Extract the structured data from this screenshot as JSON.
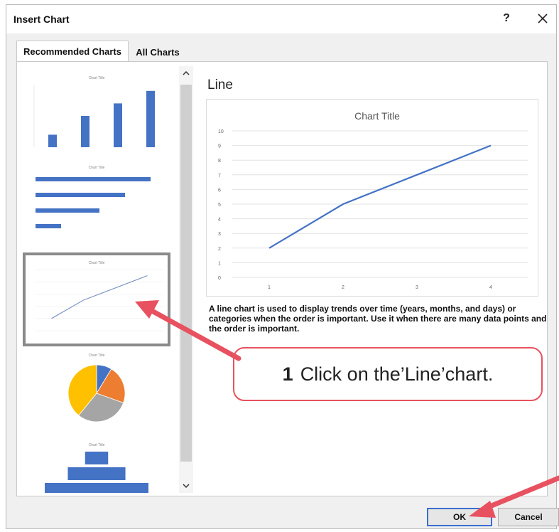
{
  "window": {
    "title": "Insert Chart",
    "help": "?",
    "close_icon": "close-icon"
  },
  "tabs": [
    {
      "label": "Recommended Charts",
      "active": true
    },
    {
      "label": "All Charts",
      "active": false
    }
  ],
  "thumbnails": [
    {
      "kind": "clustered-column",
      "title": "Chart Title",
      "values": [
        2,
        5,
        7,
        9
      ]
    },
    {
      "kind": "clustered-bar",
      "title": "Chart Title",
      "values": [
        9,
        7,
        5,
        2
      ]
    },
    {
      "kind": "line",
      "title": "Chart Title",
      "values": [
        2,
        5,
        7,
        9
      ],
      "selected": true
    },
    {
      "kind": "pie",
      "title": "Chart Title",
      "values": [
        2,
        5,
        7,
        9
      ]
    },
    {
      "kind": "funnel",
      "title": "Chart Title",
      "values": [
        2,
        5,
        9
      ]
    }
  ],
  "preview": {
    "name": "Line",
    "description": "A line chart is used to display trends over time (years, months, and days) or categories when the order is important. Use it when there are many data points and the order is important."
  },
  "chart_data": {
    "type": "line",
    "title": "Chart Title",
    "categories": [
      "1",
      "2",
      "3",
      "4"
    ],
    "values": [
      2,
      5,
      7,
      9
    ],
    "ylim": [
      0,
      10
    ],
    "yticks": [
      "0",
      "1",
      "2",
      "3",
      "4",
      "5",
      "6",
      "7",
      "8",
      "9",
      "10"
    ],
    "grid": true,
    "line_color": "#4472c4"
  },
  "callout": {
    "number": "1",
    "text": "Click on the’Line’chart."
  },
  "buttons": {
    "ok": "OK",
    "cancel": "Cancel"
  },
  "colors": {
    "accent_blue": "#4472c4",
    "annotation_red": "#e8515f",
    "pie_colors": [
      "#4472c4",
      "#ed7d31",
      "#a5a5a5",
      "#ffc000"
    ]
  }
}
